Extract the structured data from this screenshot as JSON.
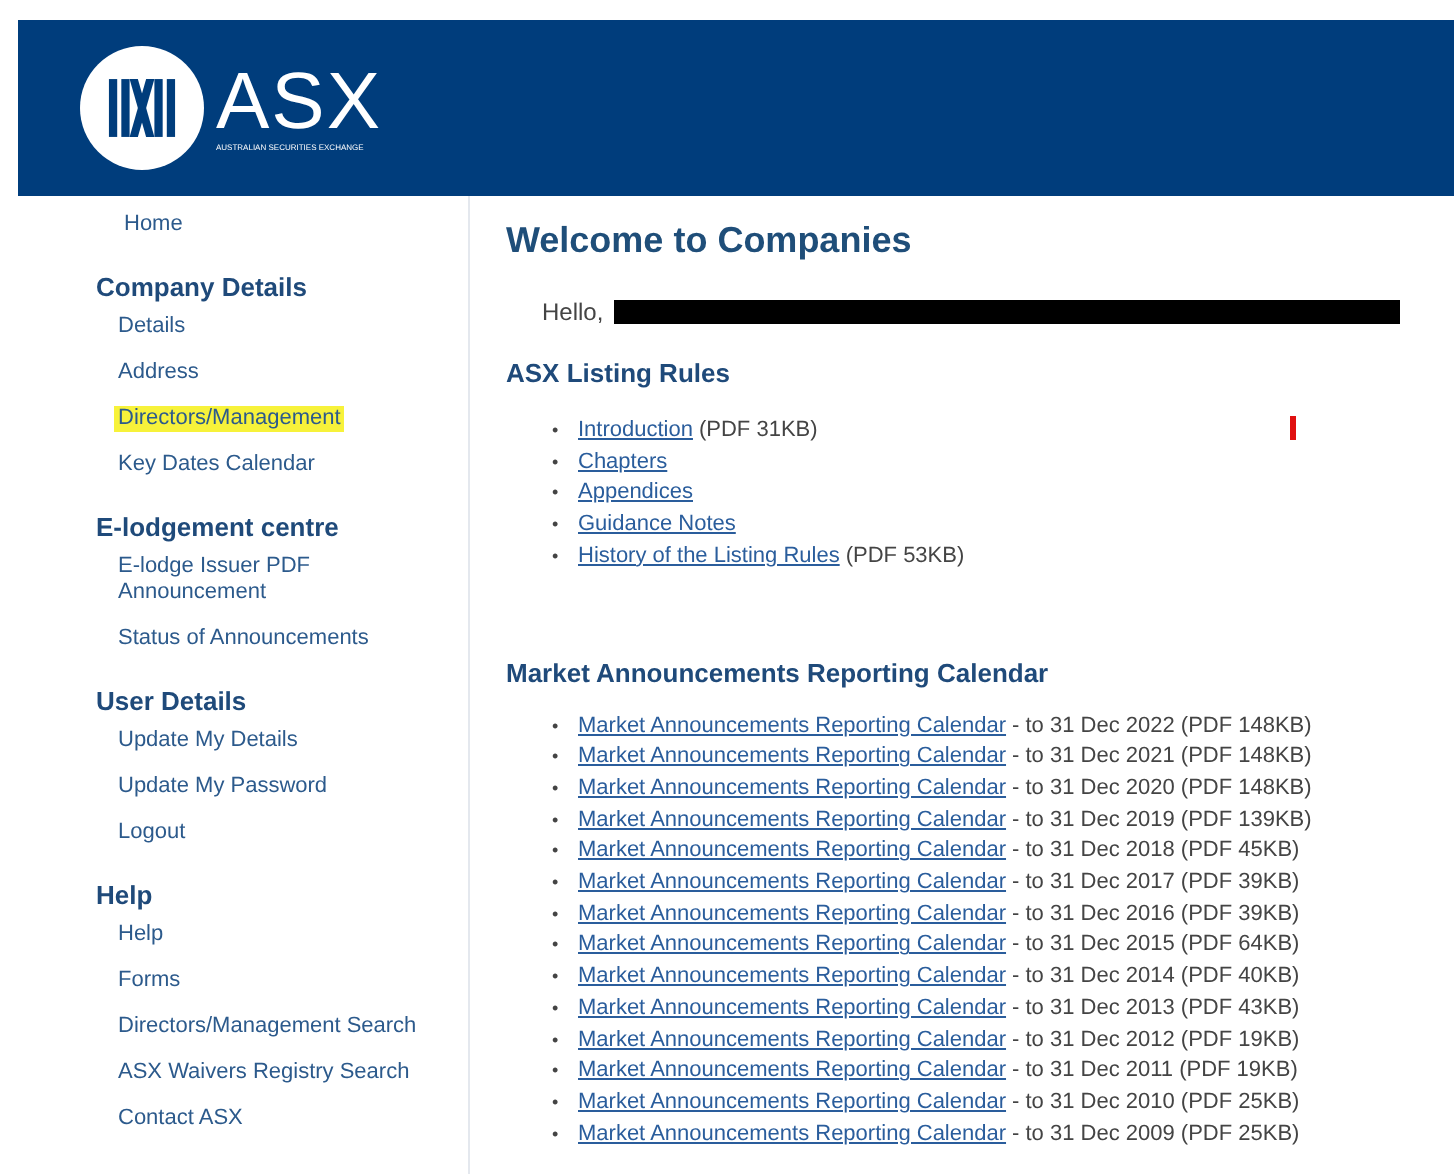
{
  "header": {
    "logo_text": "ASX",
    "logo_tagline": "AUSTRALIAN SECURITIES EXCHANGE"
  },
  "sidebar": {
    "sections": [
      {
        "kind": "link",
        "label": "Home",
        "highlighted": false
      },
      {
        "kind": "heading",
        "label": "Company Details"
      },
      {
        "kind": "item",
        "label": "Details",
        "highlighted": false
      },
      {
        "kind": "item",
        "label": "Address",
        "highlighted": false
      },
      {
        "kind": "item",
        "label": "Directors/Management",
        "highlighted": true
      },
      {
        "kind": "item",
        "label": "Key Dates Calendar",
        "highlighted": false
      },
      {
        "kind": "heading",
        "label": "E-lodgement centre"
      },
      {
        "kind": "item",
        "label": "E-lodge Issuer PDF Announcement",
        "highlighted": false
      },
      {
        "kind": "item",
        "label": "Status of Announcements",
        "highlighted": false
      },
      {
        "kind": "heading",
        "label": "User Details"
      },
      {
        "kind": "item",
        "label": "Update My Details",
        "highlighted": false
      },
      {
        "kind": "item",
        "label": "Update My Password",
        "highlighted": false
      },
      {
        "kind": "item",
        "label": "Logout",
        "highlighted": false
      },
      {
        "kind": "heading",
        "label": "Help"
      },
      {
        "kind": "item",
        "label": "Help",
        "highlighted": false
      },
      {
        "kind": "item",
        "label": "Forms",
        "highlighted": false
      },
      {
        "kind": "item",
        "label": "Directors/Management Search",
        "highlighted": false
      },
      {
        "kind": "item",
        "label": "ASX Waivers Registry Search",
        "highlighted": false
      },
      {
        "kind": "item",
        "label": "Contact ASX",
        "highlighted": false
      }
    ]
  },
  "main": {
    "title": "Welcome to Companies",
    "greeting": "Hello,",
    "name_redacted": true,
    "listing_rules": {
      "heading": "ASX Listing Rules",
      "items": [
        {
          "bullet": "•",
          "link": "Introduction",
          "note": "(PDF 31KB)"
        },
        {
          "bullet": "•",
          "link": "Chapters"
        },
        {
          "bullet": "•",
          "link": "Appendices"
        },
        {
          "bullet": "•",
          "link": "Guidance Notes"
        },
        {
          "bullet": "•",
          "link": "History of the Listing Rules",
          "note": "(PDF 53KB)"
        }
      ]
    },
    "calendar": {
      "heading": "Market Announcements Reporting Calendar",
      "items": [
        {
          "bullet": "•",
          "link": "Market Announcements Reporting Calendar",
          "note": "- to 31 Dec 2022 (PDF 148KB)"
        },
        {
          "bullet": "•",
          "link": "Market Announcements Reporting Calendar",
          "note": "- to 31 Dec 2021 (PDF 148KB)"
        },
        {
          "bullet": "•",
          "link": "Market Announcements Reporting Calendar",
          "note": "- to 31 Dec 2020 (PDF 148KB)"
        },
        {
          "bullet": "•",
          "link": "Market Announcements Reporting Calendar",
          "note": "- to 31 Dec 2019 (PDF 139KB)"
        },
        {
          "bullet": "•",
          "link": "Market Announcements Reporting Calendar",
          "note": "- to 31 Dec 2018 (PDF 45KB)"
        },
        {
          "bullet": "•",
          "link": "Market Announcements Reporting Calendar",
          "note": "- to 31 Dec 2017 (PDF 39KB)"
        },
        {
          "bullet": "•",
          "link": "Market Announcements Reporting Calendar",
          "note": "- to 31 Dec 2016 (PDF 39KB)"
        },
        {
          "bullet": "•",
          "link": "Market Announcements Reporting Calendar",
          "note": "- to 31 Dec 2015 (PDF 64KB)"
        },
        {
          "bullet": "•",
          "link": "Market Announcements Reporting Calendar",
          "note": "- to 31 Dec 2014 (PDF 40KB)"
        },
        {
          "bullet": "•",
          "link": "Market Announcements Reporting Calendar",
          "note": "- to 31 Dec 2013 (PDF 43KB)"
        },
        {
          "bullet": "•",
          "link": "Market Announcements Reporting Calendar",
          "note": "- to 31 Dec 2012 (PDF 19KB)"
        },
        {
          "bullet": "•",
          "link": "Market Announcements Reporting Calendar",
          "note": "- to 31 Dec 2011 (PDF 19KB)"
        },
        {
          "bullet": "•",
          "link": "Market Announcements Reporting Calendar",
          "note": "- to 31 Dec 2010 (PDF 25KB)"
        },
        {
          "bullet": "•",
          "link": "Market Announcements Reporting Calendar",
          "note": "- to 31 Dec 2009 (PDF 25KB)"
        }
      ]
    }
  }
}
